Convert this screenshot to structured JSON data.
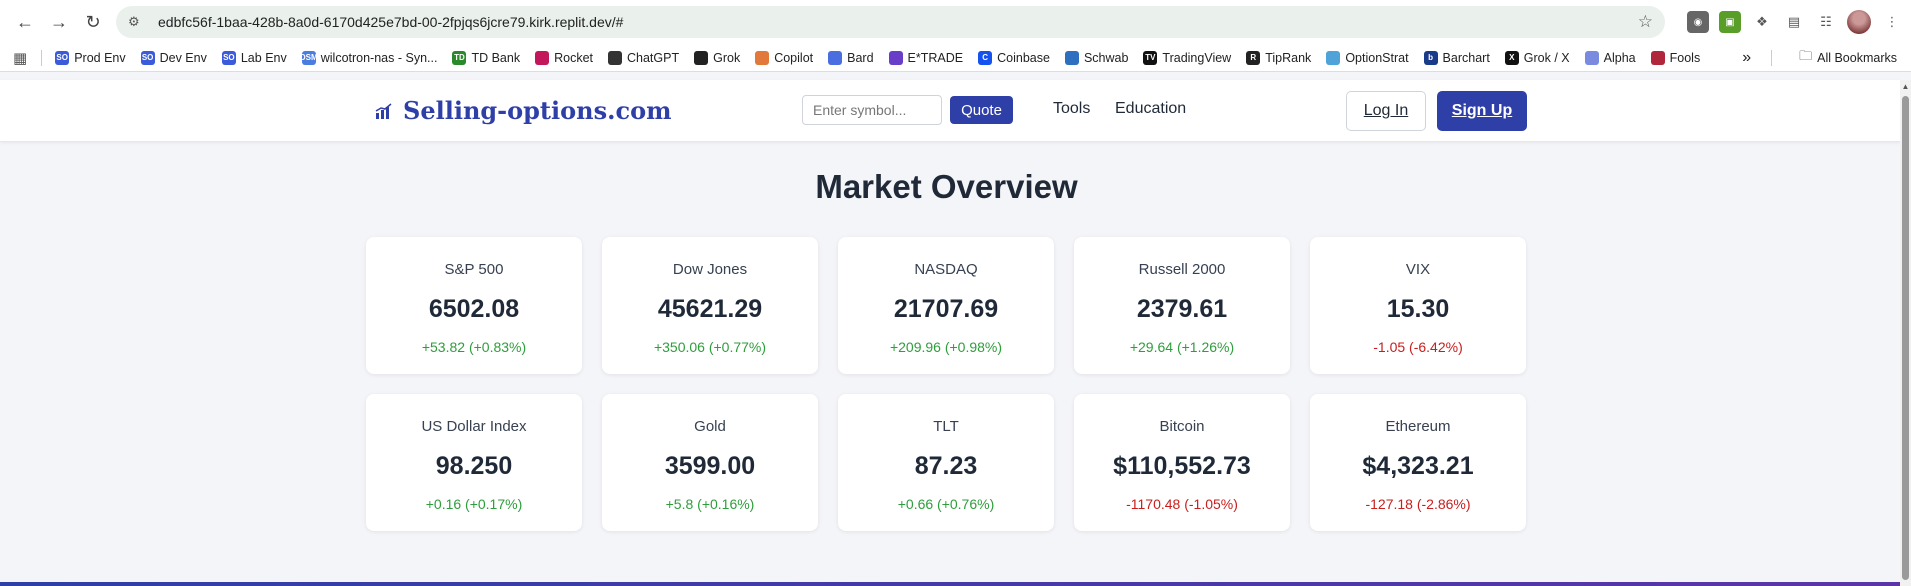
{
  "browser": {
    "url": "edbfc56f-1baa-428b-8a0d-6170d425e7bd-00-2fpjqs6jcre79.kirk.replit.dev/#",
    "bookmarks": [
      {
        "label": "Prod Env",
        "icon": "so-icon",
        "color": "#3b5bdb",
        "glyph": "SO"
      },
      {
        "label": "Dev Env",
        "icon": "so-icon",
        "color": "#3b5bdb",
        "glyph": "SO"
      },
      {
        "label": "Lab Env",
        "icon": "so-icon",
        "color": "#3b5bdb",
        "glyph": "SO"
      },
      {
        "label": "wilcotron-nas - Syn...",
        "icon": "dsm-icon",
        "color": "#4a7de0",
        "glyph": "DSM"
      },
      {
        "label": "TD Bank",
        "icon": "td-icon",
        "color": "#2a8a2a",
        "glyph": "TD"
      },
      {
        "label": "Rocket",
        "icon": "rocket-icon",
        "color": "#c2185b",
        "glyph": ""
      },
      {
        "label": "ChatGPT",
        "icon": "chatgpt-icon",
        "color": "#333333",
        "glyph": ""
      },
      {
        "label": "Grok",
        "icon": "grok-icon",
        "color": "#222222",
        "glyph": ""
      },
      {
        "label": "Copilot",
        "icon": "copilot-icon",
        "color": "#e0793b",
        "glyph": ""
      },
      {
        "label": "Bard",
        "icon": "bard-icon",
        "color": "#4a6ee0",
        "glyph": ""
      },
      {
        "label": "E*TRADE",
        "icon": "etrade-icon",
        "color": "#6a3dc8",
        "glyph": ""
      },
      {
        "label": "Coinbase",
        "icon": "coinbase-icon",
        "color": "#1652f0",
        "glyph": "C"
      },
      {
        "label": "Schwab",
        "icon": "schwab-icon",
        "color": "#2f6fc0",
        "glyph": ""
      },
      {
        "label": "TradingView",
        "icon": "tradingview-icon",
        "color": "#111111",
        "glyph": "TV"
      },
      {
        "label": "TipRank",
        "icon": "tiprank-icon",
        "color": "#222222",
        "glyph": "R"
      },
      {
        "label": "OptionStrat",
        "icon": "optionstrat-icon",
        "color": "#4fa3d9",
        "glyph": ""
      },
      {
        "label": "Barchart",
        "icon": "barchart-icon",
        "color": "#1a3a8a",
        "glyph": "b"
      },
      {
        "label": "Grok / X",
        "icon": "x-icon",
        "color": "#111111",
        "glyph": "X"
      },
      {
        "label": "Alpha",
        "icon": "alpha-icon",
        "color": "#7a8ae0",
        "glyph": ""
      },
      {
        "label": "Fools",
        "icon": "fools-icon",
        "color": "#b0263a",
        "glyph": ""
      }
    ],
    "all_bookmarks_label": "All Bookmarks",
    "more_label": "»"
  },
  "header": {
    "site_name": "Selling-options.com",
    "symbol_placeholder": "Enter symbol...",
    "quote_label": "Quote",
    "nav": [
      "Tools",
      "Education"
    ],
    "login_label": "Log In",
    "signup_label": "Sign Up"
  },
  "main": {
    "title": "Market Overview",
    "cards": [
      {
        "name": "S&P 500",
        "price": "6502.08",
        "change": "+53.82 (+0.83%)",
        "direction": "up"
      },
      {
        "name": "Dow Jones",
        "price": "45621.29",
        "change": "+350.06 (+0.77%)",
        "direction": "up"
      },
      {
        "name": "NASDAQ",
        "price": "21707.69",
        "change": "+209.96 (+0.98%)",
        "direction": "up"
      },
      {
        "name": "Russell 2000",
        "price": "2379.61",
        "change": "+29.64 (+1.26%)",
        "direction": "up"
      },
      {
        "name": "VIX",
        "price": "15.30",
        "change": "-1.05 (-6.42%)",
        "direction": "down"
      },
      {
        "name": "US Dollar Index",
        "price": "98.250",
        "change": "+0.16 (+0.17%)",
        "direction": "up"
      },
      {
        "name": "Gold",
        "price": "3599.00",
        "change": "+5.8 (+0.16%)",
        "direction": "up"
      },
      {
        "name": "TLT",
        "price": "87.23",
        "change": "+0.66 (+0.76%)",
        "direction": "up"
      },
      {
        "name": "Bitcoin",
        "price": "$110,552.73",
        "change": "-1170.48 (-1.05%)",
        "direction": "down"
      },
      {
        "name": "Ethereum",
        "price": "$4,323.21",
        "change": "-127.18 (-2.86%)",
        "direction": "down"
      }
    ]
  },
  "colors": {
    "brand": "#2f3fa8",
    "up": "#2e9e3c",
    "down": "#c81e1e"
  }
}
